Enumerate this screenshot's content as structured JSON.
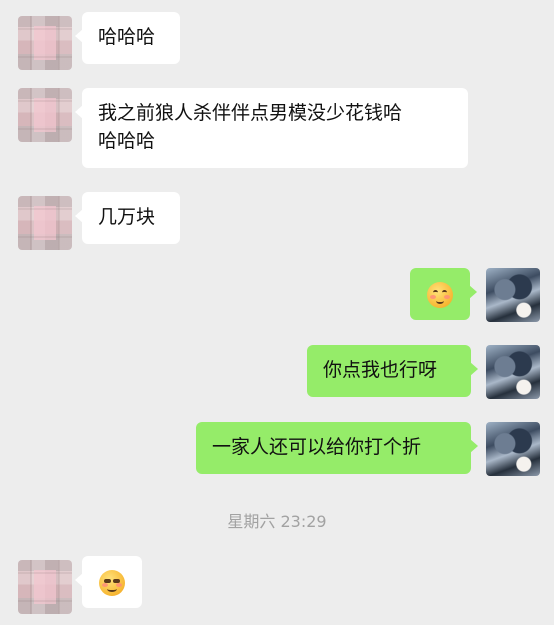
{
  "messages": [
    {
      "side": "in",
      "text": "哈哈哈"
    },
    {
      "side": "in",
      "text_line1": "我之前狼人杀伴伴点男模没少花钱哈",
      "text_line2": "哈哈哈"
    },
    {
      "side": "in",
      "text": "几万块"
    },
    {
      "side": "out",
      "emoji": "blushing-smile-emoji"
    },
    {
      "side": "out",
      "text": "你点我也行呀"
    },
    {
      "side": "out",
      "text": "一家人还可以给你打个折"
    },
    {
      "side": "in",
      "emoji": "grinning-squint-emoji"
    }
  ],
  "timestamp": "星期六 23:29",
  "colors": {
    "background": "#ededed",
    "incoming_bubble": "#ffffff",
    "outgoing_bubble": "#95ec69",
    "timestamp_text": "#a2a2a2"
  }
}
